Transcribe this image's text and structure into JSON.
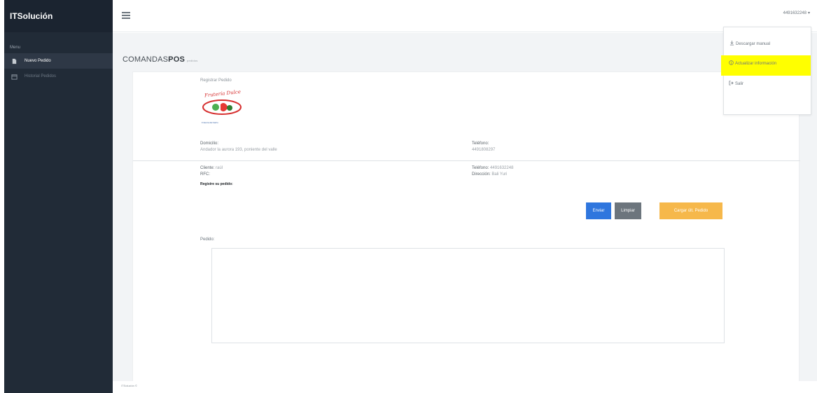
{
  "sidebar": {
    "brand": "ITSolución",
    "menu_heading": "Menu",
    "items": [
      {
        "label": "Nuevo Pedido",
        "icon": "file-icon",
        "active": true
      },
      {
        "label": "Historial Pedidos",
        "icon": "calendar-icon",
        "active": false
      }
    ]
  },
  "topbar": {
    "user": "4491632248"
  },
  "user_menu": {
    "items": [
      {
        "label": "Descargar manual",
        "icon": "download-icon"
      },
      {
        "label": "Actualizar información",
        "icon": "info-icon",
        "highlighted": true
      },
      {
        "label": "Salir",
        "icon": "logout-icon"
      }
    ],
    "highlight_color": "#ffff00"
  },
  "page": {
    "title_light": "COMANDAS",
    "title_bold": "POS",
    "subtitle": "pedidos"
  },
  "form": {
    "title": "Registrar Pedido",
    "logo_text": "Frutería Dulce",
    "logo_caption": "Frutería del barrio",
    "domicilio_label": "Domicilio:",
    "domicilio_value": "Andador la aurora 193, poniente del valle",
    "telefono_label": "Teléfono:",
    "telefono_value": "4491808297",
    "cliente_label": "Cliente:",
    "cliente_value": "raúl",
    "telefono_cliente_label": "Teléfono:",
    "telefono_cliente_value": "4491632248",
    "rfc_label": "RFC:",
    "direccion_label": "Dirección:",
    "direccion_value": "Bali Yuri",
    "registro_label": "Registre su pedido:",
    "buttons": {
      "send": "Enviar",
      "clear": "Limpiar",
      "load": "Cargar últ. Pedido"
    },
    "pedido_label": "Pedido:",
    "pedido_value": ""
  },
  "footer": {
    "text": "ITSolución ©"
  },
  "colors": {
    "sidebar_bg": "#212b37",
    "primary": "#2f76de",
    "secondary": "#6c757d",
    "warning": "#f6b84b"
  }
}
